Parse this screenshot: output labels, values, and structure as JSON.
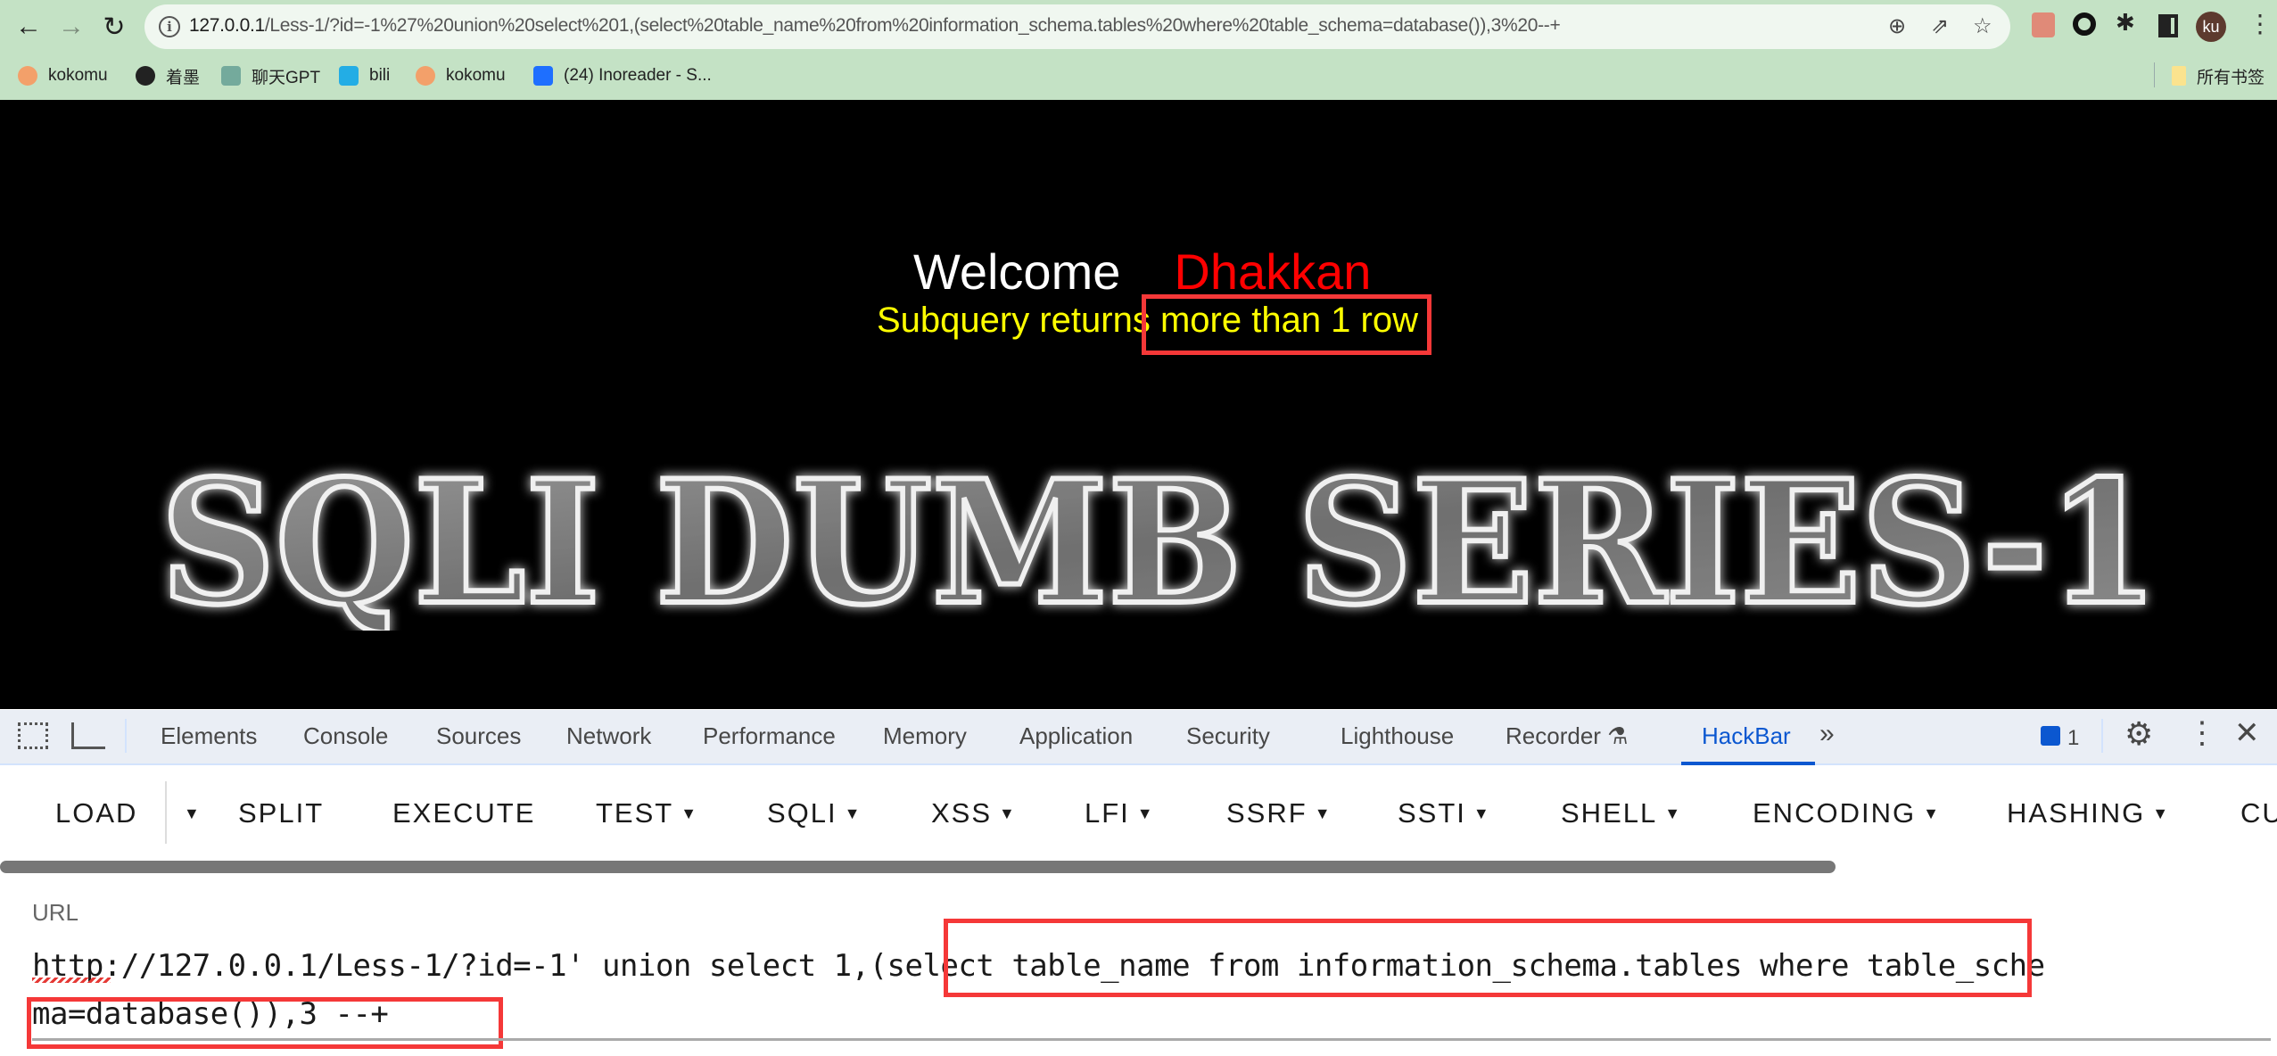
{
  "browser": {
    "address_bar": {
      "host": "127.0.0.1",
      "path": "/Less-1/?id=-1%27%20union%20select%201,(select%20table_name%20from%20information_schema.tables%20where%20table_schema=database()),3%20--+"
    },
    "profile_initials": "ku",
    "bookmarks": [
      {
        "label": "kokomu",
        "icon": "peach-icon"
      },
      {
        "label": "着墨",
        "icon": "github-icon"
      },
      {
        "label": "聊天GPT",
        "icon": "openai-icon"
      },
      {
        "label": "bili",
        "icon": "bilibili-icon"
      },
      {
        "label": "kokomu",
        "icon": "peach-icon"
      },
      {
        "label": "(24) Inoreader - S...",
        "icon": "inoreader-icon"
      }
    ],
    "all_bookmarks_label": "所有书签"
  },
  "page": {
    "welcome": "Welcome",
    "user_name": "Dhakkan",
    "error_prefix": "Subquery returns",
    "error_highlight": "more than 1 row",
    "banner_title": "SQLI DUMB SERIES-1",
    "colors": {
      "background": "#000000",
      "welcome": "#ffffff",
      "name": "#ff0000",
      "error": "#ffff00",
      "highlight_box": "#f53838"
    }
  },
  "devtools": {
    "tabs": [
      "Elements",
      "Console",
      "Sources",
      "Network",
      "Performance",
      "Memory",
      "Application",
      "Security",
      "Lighthouse",
      "Recorder",
      "HackBar"
    ],
    "active_tab": "HackBar",
    "issues_count": "1"
  },
  "hackbar": {
    "buttons": [
      {
        "label": "LOAD",
        "dropdown": false
      },
      {
        "label": "SPLIT",
        "dropdown": false
      },
      {
        "label": "EXECUTE",
        "dropdown": false
      },
      {
        "label": "TEST",
        "dropdown": true
      },
      {
        "label": "SQLI",
        "dropdown": true
      },
      {
        "label": "XSS",
        "dropdown": true
      },
      {
        "label": "LFI",
        "dropdown": true
      },
      {
        "label": "SSRF",
        "dropdown": true
      },
      {
        "label": "SSTI",
        "dropdown": true
      },
      {
        "label": "SHELL",
        "dropdown": true
      },
      {
        "label": "ENCODING",
        "dropdown": true
      },
      {
        "label": "HASHING",
        "dropdown": true
      },
      {
        "label": "CU",
        "dropdown": false
      }
    ],
    "url_label": "URL",
    "url_value": "http://127.0.0.1/Less-1/?id=-1' union select 1,(select table_name from information_schema.tables where table_schema=database()),3 --+"
  }
}
